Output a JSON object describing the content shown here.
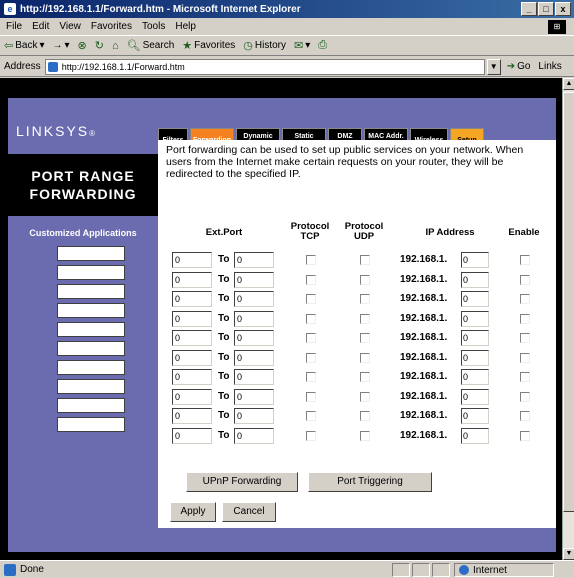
{
  "window": {
    "title": "http://192.168.1.1/Forward.htm - Microsoft Internet Explorer",
    "controls": [
      "_",
      "□",
      "x"
    ]
  },
  "menu": [
    "File",
    "Edit",
    "View",
    "Favorites",
    "Tools",
    "Help"
  ],
  "toolbar": {
    "back": "Back",
    "forward": "→",
    "search": "Search",
    "favorites": "Favorites",
    "history": "History"
  },
  "address": {
    "label": "Address",
    "url": "http://192.168.1.1/Forward.htm",
    "go": "Go",
    "links": "Links"
  },
  "page": {
    "logo": "LINKSYS",
    "tabs": [
      {
        "label": "Filters",
        "state": "normal"
      },
      {
        "label": "Forwarding",
        "state": "active"
      },
      {
        "label": "Dynamic Routing",
        "state": "normal"
      },
      {
        "label": "Static Routing",
        "state": "normal"
      },
      {
        "label": "DMZ Host",
        "state": "normal"
      },
      {
        "label": "MAC Addr. Clone",
        "state": "normal"
      },
      {
        "label": "Wireless",
        "state": "normal"
      },
      {
        "label": "Setup",
        "state": "setup"
      }
    ],
    "section_title_line1": "PORT RANGE",
    "section_title_line2": "FORWARDING",
    "description": "Port forwarding can be used to set up public services on your network. When users from the Internet make certain requests on your router, they will be redirected to the specified IP.",
    "left_title": "Customized Applications",
    "headers": {
      "ext_port": "Ext.Port",
      "protocol_tcp": "Protocol TCP",
      "protocol_udp": "Protocol UDP",
      "ip_address": "IP Address",
      "enable": "Enable"
    },
    "to_label": "To",
    "ip_prefix": "192.168.1.",
    "rows": [
      {
        "from": "0",
        "to": "0",
        "ip": "0"
      },
      {
        "from": "0",
        "to": "0",
        "ip": "0"
      },
      {
        "from": "0",
        "to": "0",
        "ip": "0"
      },
      {
        "from": "0",
        "to": "0",
        "ip": "0"
      },
      {
        "from": "0",
        "to": "0",
        "ip": "0"
      },
      {
        "from": "0",
        "to": "0",
        "ip": "0"
      },
      {
        "from": "0",
        "to": "0",
        "ip": "0"
      },
      {
        "from": "0",
        "to": "0",
        "ip": "0"
      },
      {
        "from": "0",
        "to": "0",
        "ip": "0"
      },
      {
        "from": "0",
        "to": "0",
        "ip": "0"
      }
    ],
    "buttons": {
      "upnp": "UPnP Forwarding",
      "trigger": "Port Triggering",
      "apply": "Apply",
      "cancel": "Cancel"
    }
  },
  "status": {
    "text": "Done",
    "zone": "Internet"
  },
  "colors": {
    "brand_purple": "#6b6bb0",
    "tab_active": "#f58220",
    "tab_setup": "#f5a623",
    "title_bar": "#0a246a"
  }
}
